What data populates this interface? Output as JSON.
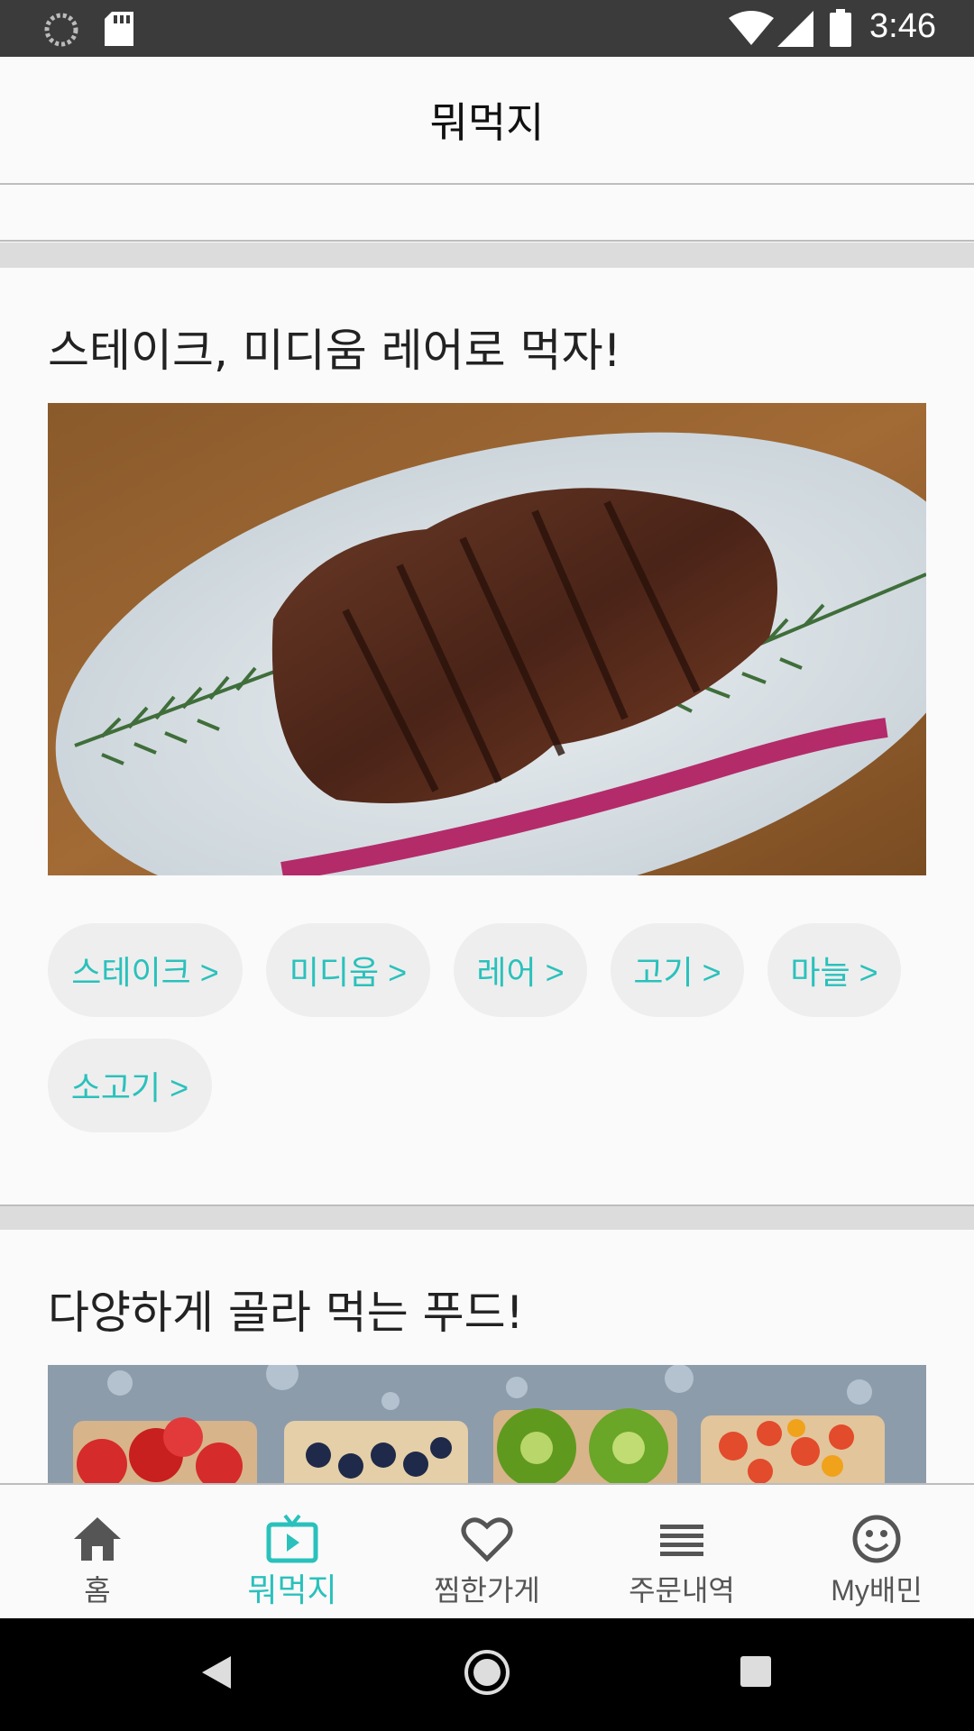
{
  "status_bar": {
    "time": "3:46",
    "icons": [
      "loading-icon",
      "sd-card-icon",
      "wifi-icon",
      "signal-icon",
      "battery-icon"
    ]
  },
  "app_bar": {
    "title": "뭐먹지"
  },
  "cards": [
    {
      "title": "스테이크, 미디움 레어로 먹자!",
      "image": "steak-on-plate-photo",
      "tags": [
        "스테이크 >",
        "미디움 >",
        "레어 >",
        "고기 >",
        "마늘 >",
        "소고기 >"
      ]
    },
    {
      "title": "다양하게 골라 먹는 푸드!",
      "image": "fruit-toasts-photo"
    }
  ],
  "bottom_nav": {
    "items": [
      {
        "label": "홈",
        "icon": "home-icon"
      },
      {
        "label": "뭐먹지",
        "icon": "tv-play-icon"
      },
      {
        "label": "찜한가게",
        "icon": "heart-icon"
      },
      {
        "label": "주문내역",
        "icon": "list-icon"
      },
      {
        "label": "My배민",
        "icon": "smiley-icon"
      }
    ],
    "active_index": 1
  },
  "colors": {
    "accent": "#2ac1bc",
    "status_bar": "#3b3b3b",
    "background": "#fafafa",
    "tag_background": "#eeeeee"
  }
}
